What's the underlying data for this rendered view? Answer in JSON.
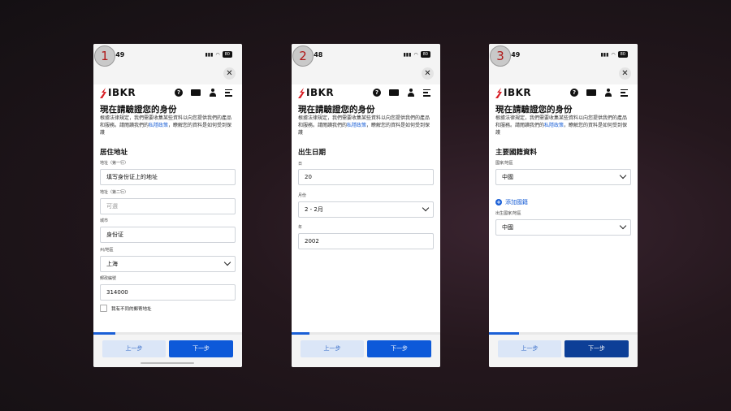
{
  "screens": [
    {
      "step": "1",
      "time": ":49",
      "battery": "80",
      "brand": "IBKR",
      "title": "現在請驗證您的身份",
      "desc_pre": "根據法律規定，我們需要收集某些資料以向您提供我們的產品和服務。請閱讀我們的",
      "desc_link": "私隱政策",
      "desc_post": "，瞭解您的資料是如何受到保護",
      "section": "居住地址",
      "fields": {
        "addr1_label": "地址（第一行）",
        "addr1_value": "填写身份证上的地址",
        "addr2_label": "地址（第二行）",
        "addr2_placeholder": "可選",
        "city_label": "城市",
        "city_value": "身份证",
        "state_label": "州/地區",
        "state_value": "上海",
        "zip_label": "郵政編號",
        "zip_value": "314000",
        "checkbox_label": "我有不同的郵寄地址"
      },
      "progress": 0.15,
      "prev_label": "上一步",
      "next_label": "下一步"
    },
    {
      "step": "2",
      "time": ":48",
      "battery": "80",
      "brand": "IBKR",
      "title": "現在請驗證您的身份",
      "desc_pre": "根據法律規定，我們需要收集某些資料以向您提供我們的產品和服務。請閱讀我們的",
      "desc_link": "私隱政策",
      "desc_post": "，瞭解您的資料是如何受到保護",
      "section": "出生日期",
      "fields": {
        "day_label": "日",
        "day_value": "20",
        "month_label": "月份",
        "month_value": "2 - 2月",
        "year_label": "年",
        "year_value": "2002"
      },
      "progress": 0.12,
      "prev_label": "上一步",
      "next_label": "下一步"
    },
    {
      "step": "3",
      "time": ":49",
      "battery": "80",
      "brand": "IBKR",
      "title": "現在請驗證您的身份",
      "desc_pre": "根據法律規定，我們需要收集某些資料以向您提供我們的產品和服務。請閱讀我們的",
      "desc_link": "私隱政策",
      "desc_post": "，瞭解您的資料是如何受到保護",
      "section": "主要國籍資料",
      "fields": {
        "country_label": "國家/地區",
        "country_value": "中國",
        "add_nationality": "添加國籍",
        "birth_country_label": "出生國家/地區",
        "birth_country_value": "中國"
      },
      "progress": 0.2,
      "prev_label": "上一步",
      "next_label": "下一步"
    }
  ],
  "colors": {
    "accent": "#0d59d9",
    "link": "#1a5fd6",
    "badge_text": "#b01818"
  }
}
